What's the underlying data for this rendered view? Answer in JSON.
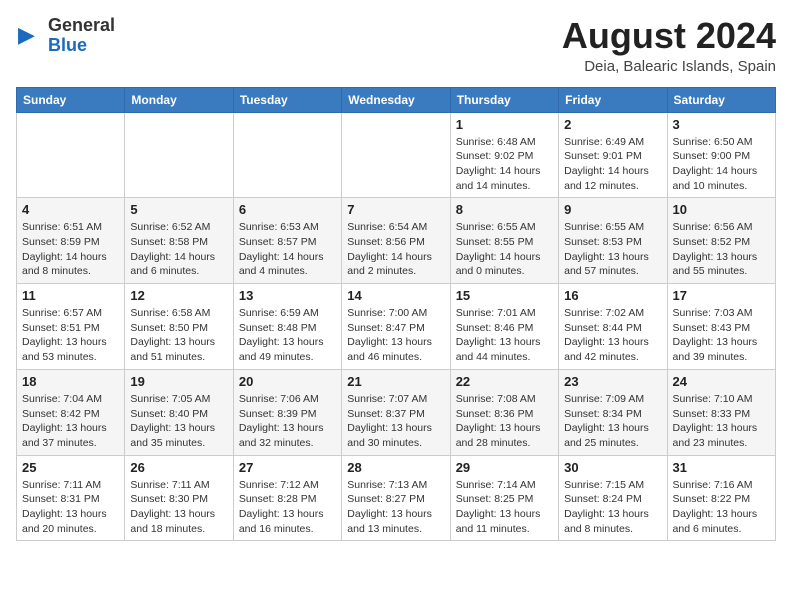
{
  "header": {
    "logo_general": "General",
    "logo_blue": "Blue",
    "month_year": "August 2024",
    "location": "Deia, Balearic Islands, Spain"
  },
  "weekdays": [
    "Sunday",
    "Monday",
    "Tuesday",
    "Wednesday",
    "Thursday",
    "Friday",
    "Saturday"
  ],
  "weeks": [
    [
      {
        "day": "",
        "info": ""
      },
      {
        "day": "",
        "info": ""
      },
      {
        "day": "",
        "info": ""
      },
      {
        "day": "",
        "info": ""
      },
      {
        "day": "1",
        "info": "Sunrise: 6:48 AM\nSunset: 9:02 PM\nDaylight: 14 hours and 14 minutes."
      },
      {
        "day": "2",
        "info": "Sunrise: 6:49 AM\nSunset: 9:01 PM\nDaylight: 14 hours and 12 minutes."
      },
      {
        "day": "3",
        "info": "Sunrise: 6:50 AM\nSunset: 9:00 PM\nDaylight: 14 hours and 10 minutes."
      }
    ],
    [
      {
        "day": "4",
        "info": "Sunrise: 6:51 AM\nSunset: 8:59 PM\nDaylight: 14 hours and 8 minutes."
      },
      {
        "day": "5",
        "info": "Sunrise: 6:52 AM\nSunset: 8:58 PM\nDaylight: 14 hours and 6 minutes."
      },
      {
        "day": "6",
        "info": "Sunrise: 6:53 AM\nSunset: 8:57 PM\nDaylight: 14 hours and 4 minutes."
      },
      {
        "day": "7",
        "info": "Sunrise: 6:54 AM\nSunset: 8:56 PM\nDaylight: 14 hours and 2 minutes."
      },
      {
        "day": "8",
        "info": "Sunrise: 6:55 AM\nSunset: 8:55 PM\nDaylight: 14 hours and 0 minutes."
      },
      {
        "day": "9",
        "info": "Sunrise: 6:55 AM\nSunset: 8:53 PM\nDaylight: 13 hours and 57 minutes."
      },
      {
        "day": "10",
        "info": "Sunrise: 6:56 AM\nSunset: 8:52 PM\nDaylight: 13 hours and 55 minutes."
      }
    ],
    [
      {
        "day": "11",
        "info": "Sunrise: 6:57 AM\nSunset: 8:51 PM\nDaylight: 13 hours and 53 minutes."
      },
      {
        "day": "12",
        "info": "Sunrise: 6:58 AM\nSunset: 8:50 PM\nDaylight: 13 hours and 51 minutes."
      },
      {
        "day": "13",
        "info": "Sunrise: 6:59 AM\nSunset: 8:48 PM\nDaylight: 13 hours and 49 minutes."
      },
      {
        "day": "14",
        "info": "Sunrise: 7:00 AM\nSunset: 8:47 PM\nDaylight: 13 hours and 46 minutes."
      },
      {
        "day": "15",
        "info": "Sunrise: 7:01 AM\nSunset: 8:46 PM\nDaylight: 13 hours and 44 minutes."
      },
      {
        "day": "16",
        "info": "Sunrise: 7:02 AM\nSunset: 8:44 PM\nDaylight: 13 hours and 42 minutes."
      },
      {
        "day": "17",
        "info": "Sunrise: 7:03 AM\nSunset: 8:43 PM\nDaylight: 13 hours and 39 minutes."
      }
    ],
    [
      {
        "day": "18",
        "info": "Sunrise: 7:04 AM\nSunset: 8:42 PM\nDaylight: 13 hours and 37 minutes."
      },
      {
        "day": "19",
        "info": "Sunrise: 7:05 AM\nSunset: 8:40 PM\nDaylight: 13 hours and 35 minutes."
      },
      {
        "day": "20",
        "info": "Sunrise: 7:06 AM\nSunset: 8:39 PM\nDaylight: 13 hours and 32 minutes."
      },
      {
        "day": "21",
        "info": "Sunrise: 7:07 AM\nSunset: 8:37 PM\nDaylight: 13 hours and 30 minutes."
      },
      {
        "day": "22",
        "info": "Sunrise: 7:08 AM\nSunset: 8:36 PM\nDaylight: 13 hours and 28 minutes."
      },
      {
        "day": "23",
        "info": "Sunrise: 7:09 AM\nSunset: 8:34 PM\nDaylight: 13 hours and 25 minutes."
      },
      {
        "day": "24",
        "info": "Sunrise: 7:10 AM\nSunset: 8:33 PM\nDaylight: 13 hours and 23 minutes."
      }
    ],
    [
      {
        "day": "25",
        "info": "Sunrise: 7:11 AM\nSunset: 8:31 PM\nDaylight: 13 hours and 20 minutes."
      },
      {
        "day": "26",
        "info": "Sunrise: 7:11 AM\nSunset: 8:30 PM\nDaylight: 13 hours and 18 minutes."
      },
      {
        "day": "27",
        "info": "Sunrise: 7:12 AM\nSunset: 8:28 PM\nDaylight: 13 hours and 16 minutes."
      },
      {
        "day": "28",
        "info": "Sunrise: 7:13 AM\nSunset: 8:27 PM\nDaylight: 13 hours and 13 minutes."
      },
      {
        "day": "29",
        "info": "Sunrise: 7:14 AM\nSunset: 8:25 PM\nDaylight: 13 hours and 11 minutes."
      },
      {
        "day": "30",
        "info": "Sunrise: 7:15 AM\nSunset: 8:24 PM\nDaylight: 13 hours and 8 minutes."
      },
      {
        "day": "31",
        "info": "Sunrise: 7:16 AM\nSunset: 8:22 PM\nDaylight: 13 hours and 6 minutes."
      }
    ]
  ]
}
